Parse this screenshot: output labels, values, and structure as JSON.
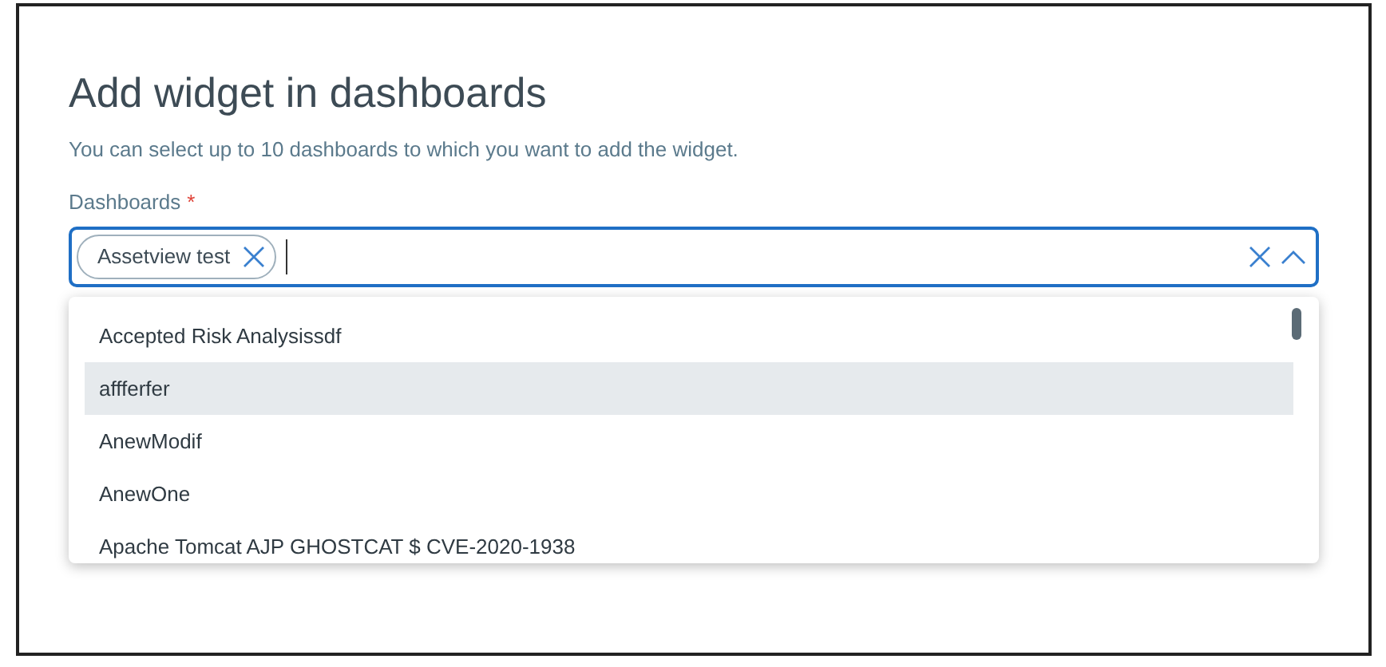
{
  "dialog": {
    "title": "Add widget in dashboards",
    "description": "You can select up to 10 dashboards to which you want to add the widget."
  },
  "field": {
    "label": "Dashboards",
    "required_mark": "*",
    "expanded": true,
    "chips": [
      {
        "label": "Assetview test"
      }
    ]
  },
  "options": [
    {
      "label": "Accepted Risk Analysissdf",
      "selected": false
    },
    {
      "label": "affferfer",
      "selected": true
    },
    {
      "label": "AnewModif",
      "selected": false
    },
    {
      "label": "AnewOne",
      "selected": false
    },
    {
      "label": "Apache Tomcat AJP GHOSTCAT $ CVE-2020-1938",
      "selected": false
    }
  ]
}
